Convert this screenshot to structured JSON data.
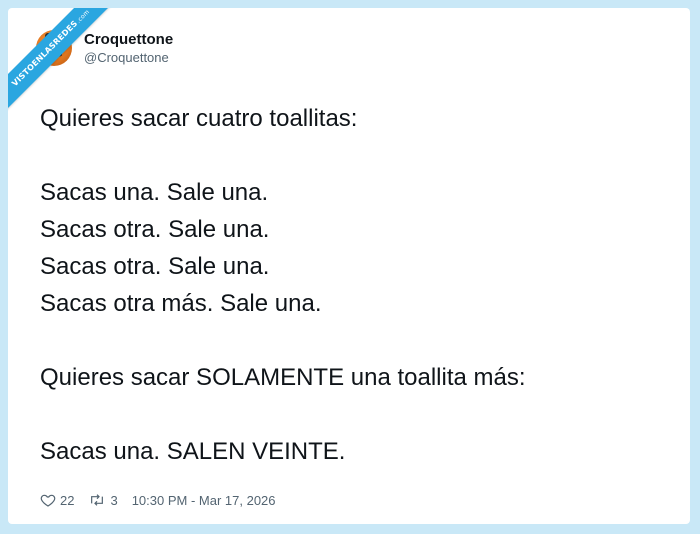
{
  "watermark": {
    "text": "VISTOENLASREDES",
    "suffix": ".com"
  },
  "user": {
    "display_name": "Croquettone",
    "handle": "@Croquettone"
  },
  "tweet": {
    "lines": [
      "Quieres sacar cuatro toallitas:",
      "",
      "Sacas una. Sale una.",
      "Sacas otra. Sale una.",
      "Sacas otra. Sale una.",
      "Sacas otra más. Sale una.",
      "",
      "Quieres sacar SOLAMENTE una toallita más:",
      "",
      "Sacas una. SALEN VEINTE."
    ]
  },
  "footer": {
    "likes": "22",
    "retweets": "3",
    "timestamp": "10:30 PM - Mar 17, 2026",
    "icons": [
      "heart-icon",
      "retweet-icon"
    ]
  },
  "colors": {
    "background": "#c9e8f7",
    "ribbon": "#2aa6e0",
    "text": "#0f1419",
    "muted": "#536471"
  }
}
